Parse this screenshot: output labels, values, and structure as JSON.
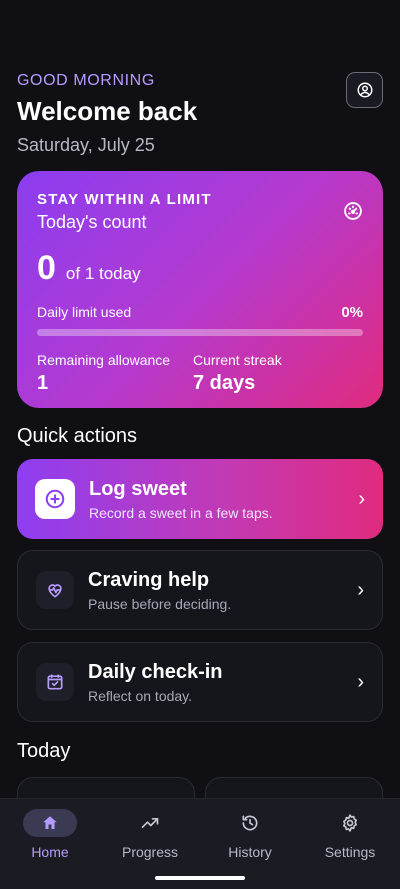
{
  "header": {
    "greeting": "GOOD MORNING",
    "title": "Welcome back",
    "date": "Saturday, July 25"
  },
  "limit_card": {
    "title": "STAY WITHIN A LIMIT",
    "subtitle": "Today's count",
    "count": "0",
    "count_suffix": "of 1 today",
    "used_label": "Daily limit used",
    "used_pct": "0%",
    "used_fraction": 0,
    "remaining_label": "Remaining allowance",
    "remaining_value": "1",
    "streak_label": "Current streak",
    "streak_value": "7 days"
  },
  "quick_actions": {
    "title": "Quick actions",
    "items": [
      {
        "title": "Log sweet",
        "subtitle": "Record a sweet in a few taps.",
        "icon": "plus-circle-icon"
      },
      {
        "title": "Craving help",
        "subtitle": "Pause before deciding.",
        "icon": "heartbeat-icon"
      },
      {
        "title": "Daily check-in",
        "subtitle": "Reflect on today.",
        "icon": "calendar-check-icon"
      }
    ]
  },
  "today": {
    "title": "Today"
  },
  "tabs": [
    {
      "label": "Home",
      "icon": "home-icon",
      "active": true
    },
    {
      "label": "Progress",
      "icon": "trend-icon",
      "active": false
    },
    {
      "label": "History",
      "icon": "history-icon",
      "active": false
    },
    {
      "label": "Settings",
      "icon": "gear-icon",
      "active": false
    }
  ],
  "colors": {
    "accent": "#b79cff",
    "gradient_start": "#8b3df0",
    "gradient_end": "#e02b7e",
    "background": "#0f0f14"
  }
}
